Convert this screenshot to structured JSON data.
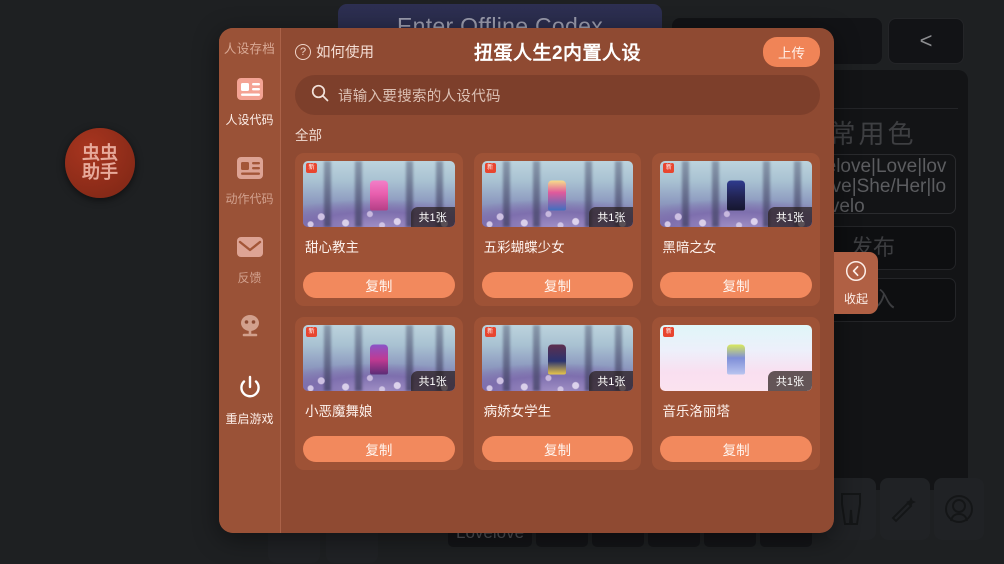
{
  "background": {
    "enter_codex_button": "Enter Offline Codex",
    "topbar_secondary": "• • •",
    "back_button": "<",
    "panel": {
      "dot_label": "·",
      "title": "常用色",
      "text_value": "Lovelove|Love|love|Love|She/Her|lovelovelo",
      "button_publish": "发布",
      "button_import": "导入"
    },
    "tags": [
      "Lovelove",
      "",
      "",
      "",
      "",
      "",
      ""
    ],
    "icon_tiles": [
      "pants-icon",
      "magic-wand-icon",
      "avatar-icon"
    ]
  },
  "floating_logo": {
    "line1": "虫虫",
    "line2": "助手"
  },
  "modal": {
    "sidebar": {
      "title": "人设存档",
      "items": [
        {
          "label": "人设代码",
          "icon": "id-card-icon",
          "active": true
        },
        {
          "label": "动作代码",
          "icon": "id-card-icon",
          "active": false
        },
        {
          "label": "反馈",
          "icon": "mail-icon",
          "active": false
        },
        {
          "label": "",
          "icon": "robot-icon",
          "active": false
        },
        {
          "label": "重启游戏",
          "icon": "power-icon",
          "active": false
        }
      ]
    },
    "header": {
      "how_to_use": "如何使用",
      "help_icon": "question-mark-icon",
      "title": "扭蛋人生2内置人设",
      "upload_label": "上传"
    },
    "search": {
      "placeholder": "请输入要搜索的人设代码",
      "value": "",
      "icon": "search-icon"
    },
    "filter": {
      "label": "全部"
    },
    "cards": [
      {
        "name": "甜心教主",
        "count": "共1张",
        "copy": "复制",
        "badge": "新",
        "scene": "forest",
        "sprite": "#e86fb6"
      },
      {
        "name": "五彩蝴蝶少女",
        "count": "共1张",
        "copy": "复制",
        "badge": "新",
        "scene": "forest",
        "sprite": "#d94f8f"
      },
      {
        "name": "黑暗之女",
        "count": "共1张",
        "copy": "复制",
        "badge": "新",
        "scene": "forest",
        "sprite": "#2a2d6e"
      },
      {
        "name": "小恶魔舞娘",
        "count": "共1张",
        "copy": "复制",
        "badge": "新",
        "scene": "forest",
        "sprite": "#a03a86"
      },
      {
        "name": "病娇女学生",
        "count": "共1张",
        "copy": "复制",
        "badge": "新",
        "scene": "forest",
        "sprite": "#3b2a50"
      },
      {
        "name": "音乐洛丽塔",
        "count": "共1张",
        "copy": "复制",
        "badge": "新",
        "scene": "pink",
        "sprite": "#cfe24f"
      }
    ]
  },
  "collapse": {
    "label": "收起",
    "icon": "chevron-left-circle-icon"
  },
  "colors": {
    "modal_bg": "#8f4a32",
    "sidebar_bg": "#9a5237",
    "card_bg": "#9e5236",
    "accent": "#f2895d",
    "search_bg": "#7d3f2b",
    "collapse_bg": "#b06044",
    "page_bg": "#1e2022"
  }
}
